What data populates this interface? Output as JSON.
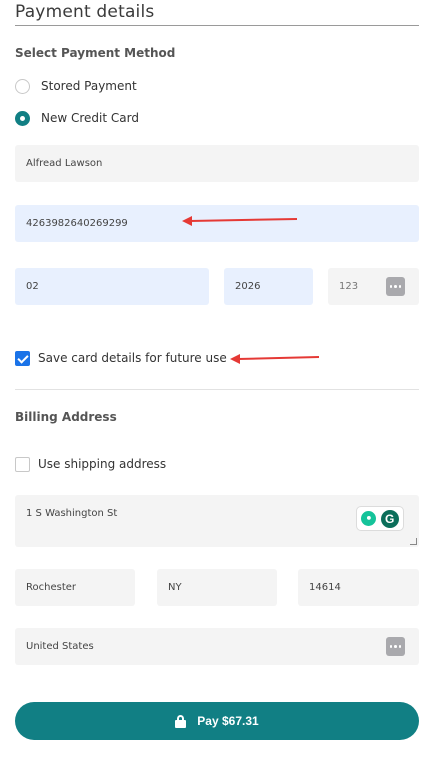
{
  "header": {
    "title": "Payment details"
  },
  "payment_method": {
    "heading": "Select Payment Method",
    "options": [
      {
        "label": "Stored Payment",
        "selected": false
      },
      {
        "label": "New Credit Card",
        "selected": true
      }
    ]
  },
  "card": {
    "name": "Alfread Lawson",
    "number": "4263982640269299",
    "exp_month": "02",
    "exp_year": "2026",
    "cvv_placeholder": "123"
  },
  "save_card": {
    "label": "Save card details for future use",
    "checked": true
  },
  "billing": {
    "heading": "Billing Address",
    "use_shipping_label": "Use shipping address",
    "use_shipping_checked": false,
    "street": "1 S Washington St",
    "city": "Rochester",
    "state": "NY",
    "zip": "14614",
    "country": "United States"
  },
  "pay_button": {
    "label": "Pay $67.31"
  },
  "colors": {
    "accent": "#117f84",
    "checkbox_blue": "#1a73e8",
    "autofill_bg": "#e8f0fe",
    "annotation_red": "#e53935"
  },
  "icons": [
    "lock-icon",
    "dots-icon",
    "grammarly-icon",
    "bulb-icon"
  ]
}
